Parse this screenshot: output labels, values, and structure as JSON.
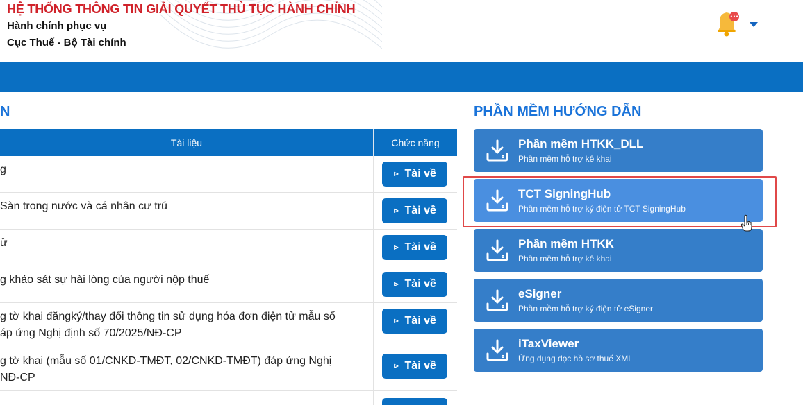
{
  "header": {
    "system_title": "HỆ THỐNG THÔNG TIN GIẢI QUYẾT THỦ TỤC HÀNH CHÍNH",
    "subtitle_1": "Hành chính phục vụ",
    "subtitle_2": "Cục Thuế - Bộ Tài chính",
    "notification_badge": "•••"
  },
  "left": {
    "heading": "N",
    "table": {
      "col_doc": "Tài liệu",
      "col_func": "Chức năng",
      "download_label": "Tài về",
      "rows": [
        "g",
        "Sàn trong nước và cá nhân cư trú",
        "ử",
        "g khảo sát sự hài lòng của người nộp thuế",
        "g tờ khai đăngký/thay đổi thông tin sử dụng hóa đơn điện tử mẫu số\náp ứng Nghị định số 70/2025/NĐ-CP",
        "g tờ khai (mẫu số 01/CNKD-TMĐT, 02/CNKD-TMĐT) đáp ứng Nghị\nNĐ-CP",
        ""
      ]
    }
  },
  "right": {
    "heading": "PHẦN MỀM HƯỚNG DẪN",
    "software": [
      {
        "name": "Phần mềm HTKK_DLL",
        "desc": "Phần mềm hỗ trợ kê khai"
      },
      {
        "name": "TCT SigningHub",
        "desc": "Phần mềm hỗ trợ ký điện tử TCT SigningHub"
      },
      {
        "name": "Phần mềm HTKK",
        "desc": "Phần mềm hỗ trợ kê khai"
      },
      {
        "name": "eSigner",
        "desc": "Phần mềm hỗ trợ ký điện tử eSigner"
      },
      {
        "name": "iTaxViewer",
        "desc": "Ứng dụng đọc hồ sơ thuế XML"
      }
    ]
  },
  "colors": {
    "title_red": "#d0222a",
    "primary_blue": "#0a6fc2",
    "software_blue": "#357ec9",
    "highlight_red": "#e04848"
  }
}
